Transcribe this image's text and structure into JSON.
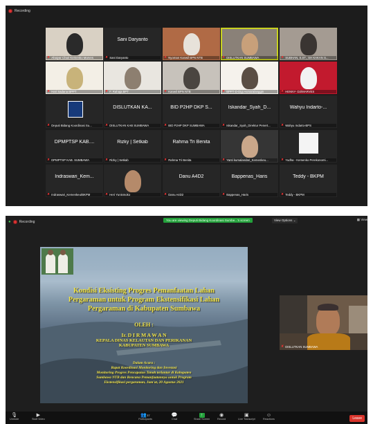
{
  "top_window": {
    "recording_label": "Recording",
    "tiles": [
      {
        "name": "Ahaiyar Chair Kemenko Marves",
        "type": "video",
        "palette": [
          "#d9d1c4",
          "#2a2a2a"
        ]
      },
      {
        "name": "Sani Daryanto",
        "type": "name",
        "center": "Sani Daryanto"
      },
      {
        "name": "Nyoman Kanwil BPN NTB",
        "type": "video",
        "palette": [
          "#b06a45",
          "#e7e2da"
        ]
      },
      {
        "name": "DISLUTKAN SUMBAWA",
        "type": "video",
        "palette": [
          "#8a8178",
          "#c8a07a"
        ],
        "active": true
      },
      {
        "name": "SUBHAN, S.ST., SH KAKAN S...",
        "type": "video",
        "palette": [
          "#a49b92",
          "#3a3532"
        ]
      },
      {
        "name": "Hari Sadana BPPT",
        "type": "video",
        "palette": [
          "#f3efe6",
          "#c8b37a"
        ]
      },
      {
        "name": "F. Rahaja BPT",
        "type": "video",
        "palette": [
          "#e9e6e0",
          "#8d7f70"
        ]
      },
      {
        "name": "Kanwil BPN NTB",
        "type": "video",
        "palette": [
          "#c7c2bb",
          "#4a4540"
        ]
      },
      {
        "name": "BPPT-D-Digi Asmaralanggin",
        "type": "video",
        "palette": [
          "#f5f2ec",
          "#5a4e44"
        ]
      },
      {
        "name": "HENNY- D2/MARVES",
        "type": "video",
        "palette": [
          "#c21a2e",
          "#f2f2f2"
        ]
      },
      {
        "name": "Deputi Bidang Koordinasi Su...",
        "type": "logo",
        "palette": [
          "#173a7a",
          "#ffffff"
        ]
      },
      {
        "name": "DISLUTKAN KAB SUMBAWA",
        "type": "name",
        "center": "DISLUTKAN KA..."
      },
      {
        "name": "BID P2HP DKP SUMBAWA",
        "type": "name",
        "center": "BID P2HP DKP S..."
      },
      {
        "name": "Iskandar_Syah_Direktur Penert...",
        "type": "name",
        "center": "Iskandar_Syah_D..."
      },
      {
        "name": "Wahyu Indarto-BPS",
        "type": "name",
        "center": "Wahyu Indarto-..."
      },
      {
        "name": "DPMPTSP KAB. SUMBAWA",
        "type": "name",
        "center": "DPMPTSP KAB...."
      },
      {
        "name": "Rizky | Setkab",
        "type": "name",
        "center": "Rizky | Setkab"
      },
      {
        "name": "Rahma Tri Benita",
        "type": "name",
        "center": "Rahma Tri Benita"
      },
      {
        "name": "Yanti kumalandari_Kemenkeu...",
        "type": "video",
        "palette": [
          "#353535",
          "#caa78a"
        ]
      },
      {
        "name": "Yudha - Kemenko Perekonomi...",
        "type": "white",
        "palette": [
          "#262626",
          "#f4f4f4"
        ]
      },
      {
        "name": "Indraswari_Kemenkeu/BKPM",
        "type": "name",
        "center": "Indraswari_Kem..."
      },
      {
        "name": "Heri Yunismoko",
        "type": "video",
        "palette": [
          "#262626",
          "#b58a6a"
        ]
      },
      {
        "name": "Danu A4D2",
        "type": "name",
        "center": "Danu A4D2"
      },
      {
        "name": "Bappenas_Haris",
        "type": "name",
        "center": "Bappenas_Haris"
      },
      {
        "name": "Teddy - BKPM",
        "type": "name",
        "center": "Teddy - BKPM"
      }
    ]
  },
  "bottom_window": {
    "recording_label": "Recording",
    "viewing_banner": "You are viewing Deputi Bidang Koordinasi Sumbe...'s screen",
    "view_options": "View Options",
    "view_right": "View",
    "slide": {
      "title_lines": [
        "Kondisi Eksisting Progres Pemanfaatan Lahan",
        "Pergaraman untuk Program Ekstensifikasi Lahan",
        "Pergaraman di Kabupaten Sumbawa"
      ],
      "oleh": "OLEH :",
      "presenter": "Ir. D I R M A W A N",
      "position_lines": [
        "KEPALA DINAS KELAUTAN DAN PERIKANAN",
        "KABUPATEN SUMBAWA"
      ],
      "agenda_lines": [
        "Dalam Acara :",
        "Rapat Koordinasi Monitoring dan Investasi",
        "Monitoring Progres Pencapaian Tanah terlantar di Kabupaten",
        "Sumbawa NTB dan Rencana Pemanfaatannya untuk Program",
        "Ekstensifikasi pergaraman, Jum'at, 20 Agustus 2021"
      ]
    },
    "speaker_name": "DISLUTKAN SUMBAWA",
    "toolbar": {
      "unmute": "Unmute",
      "start_video": "Start Video",
      "participants": "Participants",
      "participants_count": "37",
      "chat": "Chat",
      "share_screen": "Share Screen",
      "record": "Record",
      "live_transcript": "Live Transcript",
      "reactions": "Reactions",
      "leave": "Leave"
    }
  }
}
